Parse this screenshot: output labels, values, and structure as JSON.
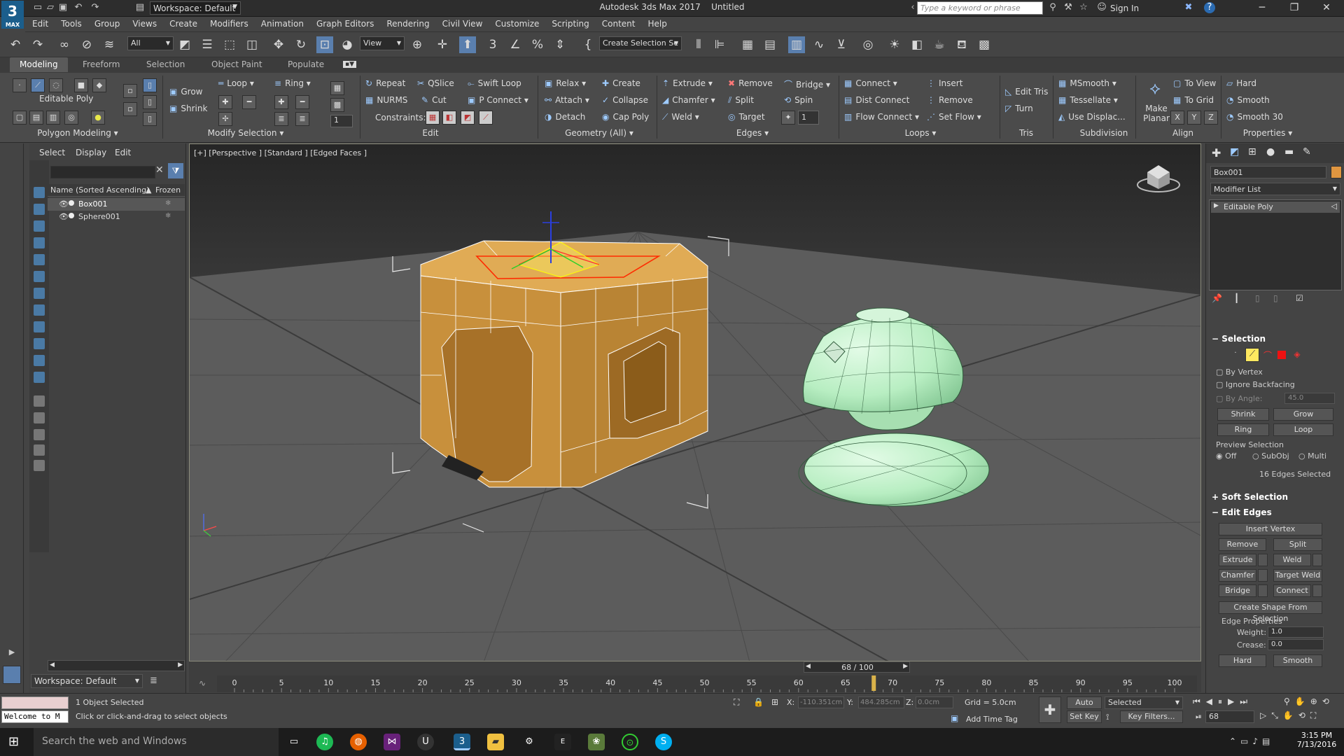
{
  "app": {
    "title": "Autodesk 3ds Max 2017",
    "doc": "Untitled",
    "logo_big": "3",
    "logo_small": "MAX",
    "workspace": "Workspace: Default",
    "search_placeholder": "Type a keyword or phrase",
    "sign_in": "Sign In"
  },
  "menu": [
    "Edit",
    "Tools",
    "Group",
    "Views",
    "Create",
    "Modifiers",
    "Animation",
    "Graph Editors",
    "Rendering",
    "Civil View",
    "Customize",
    "Scripting",
    "Content",
    "Help"
  ],
  "toolbar": {
    "filter_value": "All",
    "refcoord_value": "View",
    "selection_set": "Create Selection Se"
  },
  "ribbon_tabs": [
    "Modeling",
    "Freeform",
    "Selection",
    "Object Paint",
    "Populate"
  ],
  "ribbon": {
    "poly": {
      "title": "Editable Poly",
      "group": "Polygon Modeling"
    },
    "modsel": {
      "grow": "Grow",
      "shrink": "Shrink",
      "loop": "Loop",
      "ring": "Ring",
      "group": "Modify Selection"
    },
    "edit": {
      "repeat": "Repeat",
      "qslice": "QSlice",
      "swift": "Swift Loop",
      "nurms": "NURMS",
      "cut": "Cut",
      "pconnect": "P Connect",
      "constraints": "Constraints:",
      "spin_value": "1",
      "group": "Edit"
    },
    "geometry": {
      "relax": "Relax",
      "create": "Create",
      "attach": "Attach",
      "collapse": "Collapse",
      "detach": "Detach",
      "cappoly": "Cap Poly",
      "group": "Geometry (All)"
    },
    "edges": {
      "extrude": "Extrude",
      "remove": "Remove",
      "bridge": "Bridge",
      "chamfer": "Chamfer",
      "split": "Split",
      "spin": "Spin",
      "weld": "Weld",
      "target": "Target",
      "spin_value": "1",
      "group": "Edges"
    },
    "loops": {
      "connect": "Connect",
      "insert": "Insert",
      "distconnect": "Dist Connect",
      "remove": "Remove",
      "flowconnect": "Flow Connect",
      "setflow": "Set Flow",
      "group": "Loops"
    },
    "tris": {
      "edittris": "Edit Tris",
      "turn": "Turn",
      "group": "Tris"
    },
    "subdivision": {
      "msmooth": "MSmooth",
      "tessellate": "Tessellate",
      "usedisp": "Use Displac...",
      "group": "Subdivision"
    },
    "align": {
      "make": "Make",
      "planar": "Planar",
      "toview": "To View",
      "togrid": "To Grid",
      "x": "X",
      "y": "Y",
      "z": "Z",
      "group": "Align"
    },
    "properties": {
      "hard": "Hard",
      "smooth": "Smooth",
      "smooth30": "Smooth 30",
      "group": "Properties"
    }
  },
  "scene": {
    "menu": [
      "Select",
      "Display",
      "Edit"
    ],
    "col_name": "Name (Sorted Ascending)",
    "col_frozen": "Frozen",
    "objects": [
      "Box001",
      "Sphere001"
    ],
    "workspace": "Workspace: Default"
  },
  "viewport": {
    "label": "[+] [Perspective ] [Standard ] [Edged Faces ]"
  },
  "right": {
    "objname": "Box001",
    "modlist": "Modifier List",
    "stack_item": "Editable Poly",
    "selection": {
      "title": "Selection",
      "by_vertex": "By Vertex",
      "ignore_backfacing": "Ignore Backfacing",
      "by_angle": "By Angle:",
      "angle_value": "45.0",
      "shrink": "Shrink",
      "grow": "Grow",
      "ring": "Ring",
      "loop": "Loop",
      "preview": "Preview Selection",
      "off": "Off",
      "subobj": "SubObj",
      "multi": "Multi",
      "status": "16 Edges Selected"
    },
    "soft_selection": "Soft Selection",
    "edit_edges": {
      "title": "Edit Edges",
      "insert_vertex": "Insert Vertex",
      "remove": "Remove",
      "split": "Split",
      "extrude": "Extrude",
      "weld": "Weld",
      "chamfer": "Chamfer",
      "target_weld": "Target Weld",
      "bridge": "Bridge",
      "connect": "Connect",
      "create_shape": "Create Shape From Selection",
      "edge_props": "Edge Properties",
      "weight_label": "Weight:",
      "weight": "1.0",
      "crease_label": "Crease:",
      "crease": "0.0",
      "hard": "Hard",
      "smooth": "Smooth"
    }
  },
  "timeline": {
    "frame": "68 / 100",
    "ticks": [
      "0",
      "5",
      "10",
      "15",
      "20",
      "25",
      "30",
      "35",
      "40",
      "45",
      "50",
      "55",
      "60",
      "65",
      "70",
      "75",
      "80",
      "85",
      "90",
      "95",
      "100"
    ],
    "current": 68
  },
  "status": {
    "maxscript": "Welcome to M",
    "selected": "1 Object Selected",
    "prompt": "Click or click-and-drag to select objects",
    "x_label": "X:",
    "x": "-110.351cm",
    "y_label": "Y:",
    "y": "484.285cm",
    "z_label": "Z:",
    "z": "0.0cm",
    "grid": "Grid = 5.0cm",
    "add_time_tag": "Add Time Tag",
    "autokey": "Auto Key",
    "autokey_mode": "Selected",
    "setkey": "Set Key",
    "keyfilters": "Key Filters...",
    "frame": "68"
  },
  "taskbar": {
    "search": "Search the web and Windows",
    "time": "3:15 PM",
    "date": "7/13/2016"
  },
  "colors": {
    "accent": "#1b5e8c",
    "box": "#c8903c",
    "sphere": "#b8eec2",
    "selected_edge": "#ff2a00"
  }
}
